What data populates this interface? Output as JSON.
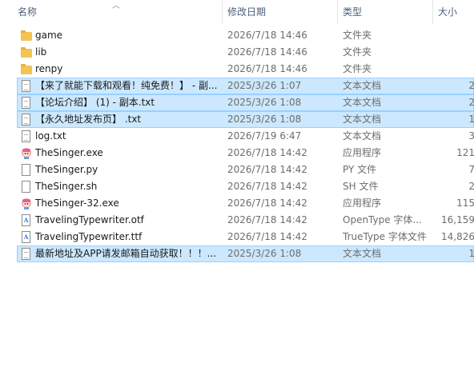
{
  "columns": {
    "name": "名称",
    "date": "修改日期",
    "type": "类型",
    "size": "大小"
  },
  "files": [
    {
      "name": "game",
      "date": "2026/7/18 14:46",
      "type": "文件夹",
      "size": "",
      "icon": "folder-icon",
      "selected": false
    },
    {
      "name": "lib",
      "date": "2026/7/18 14:46",
      "type": "文件夹",
      "size": "",
      "icon": "folder-icon",
      "selected": false
    },
    {
      "name": "renpy",
      "date": "2026/7/18 14:46",
      "type": "文件夹",
      "size": "",
      "icon": "folder-icon",
      "selected": false
    },
    {
      "name": "【来了就能下载和观看！纯免费！】 - 副...",
      "date": "2025/3/26 1:07",
      "type": "文本文档",
      "size": "2",
      "icon": "text-file-icon",
      "selected": true
    },
    {
      "name": "【论坛介绍】 (1) - 副本.txt",
      "date": "2025/3/26 1:08",
      "type": "文本文档",
      "size": "2",
      "icon": "text-file-icon",
      "selected": true
    },
    {
      "name": "【永久地址发布页】 .txt",
      "date": "2025/3/26 1:08",
      "type": "文本文档",
      "size": "1",
      "icon": "text-file-icon",
      "selected": true
    },
    {
      "name": "log.txt",
      "date": "2026/7/19 6:47",
      "type": "文本文档",
      "size": "3",
      "icon": "text-file-icon",
      "selected": false
    },
    {
      "name": "TheSinger.exe",
      "date": "2026/7/18 14:42",
      "type": "应用程序",
      "size": "121",
      "icon": "app-icon",
      "selected": false
    },
    {
      "name": "TheSinger.py",
      "date": "2026/7/18 14:42",
      "type": "PY 文件",
      "size": "7",
      "icon": "blank-file-icon",
      "selected": false
    },
    {
      "name": "TheSinger.sh",
      "date": "2026/7/18 14:42",
      "type": "SH 文件",
      "size": "2",
      "icon": "blank-file-icon",
      "selected": false
    },
    {
      "name": "TheSinger-32.exe",
      "date": "2026/7/18 14:42",
      "type": "应用程序",
      "size": "115",
      "icon": "app-icon",
      "selected": false
    },
    {
      "name": "TravelingTypewriter.otf",
      "date": "2026/7/18 14:42",
      "type": "OpenType 字体...",
      "size": "16,159",
      "icon": "font-file-icon",
      "selected": false
    },
    {
      "name": "TravelingTypewriter.ttf",
      "date": "2026/7/18 14:42",
      "type": "TrueType 字体文件",
      "size": "14,826",
      "icon": "font-file-icon",
      "selected": false
    },
    {
      "name": "最新地址及APP请发邮箱自动获取！！！...",
      "date": "2025/3/26 1:08",
      "type": "文本文档",
      "size": "1",
      "icon": "text-file-icon",
      "selected": true
    }
  ]
}
